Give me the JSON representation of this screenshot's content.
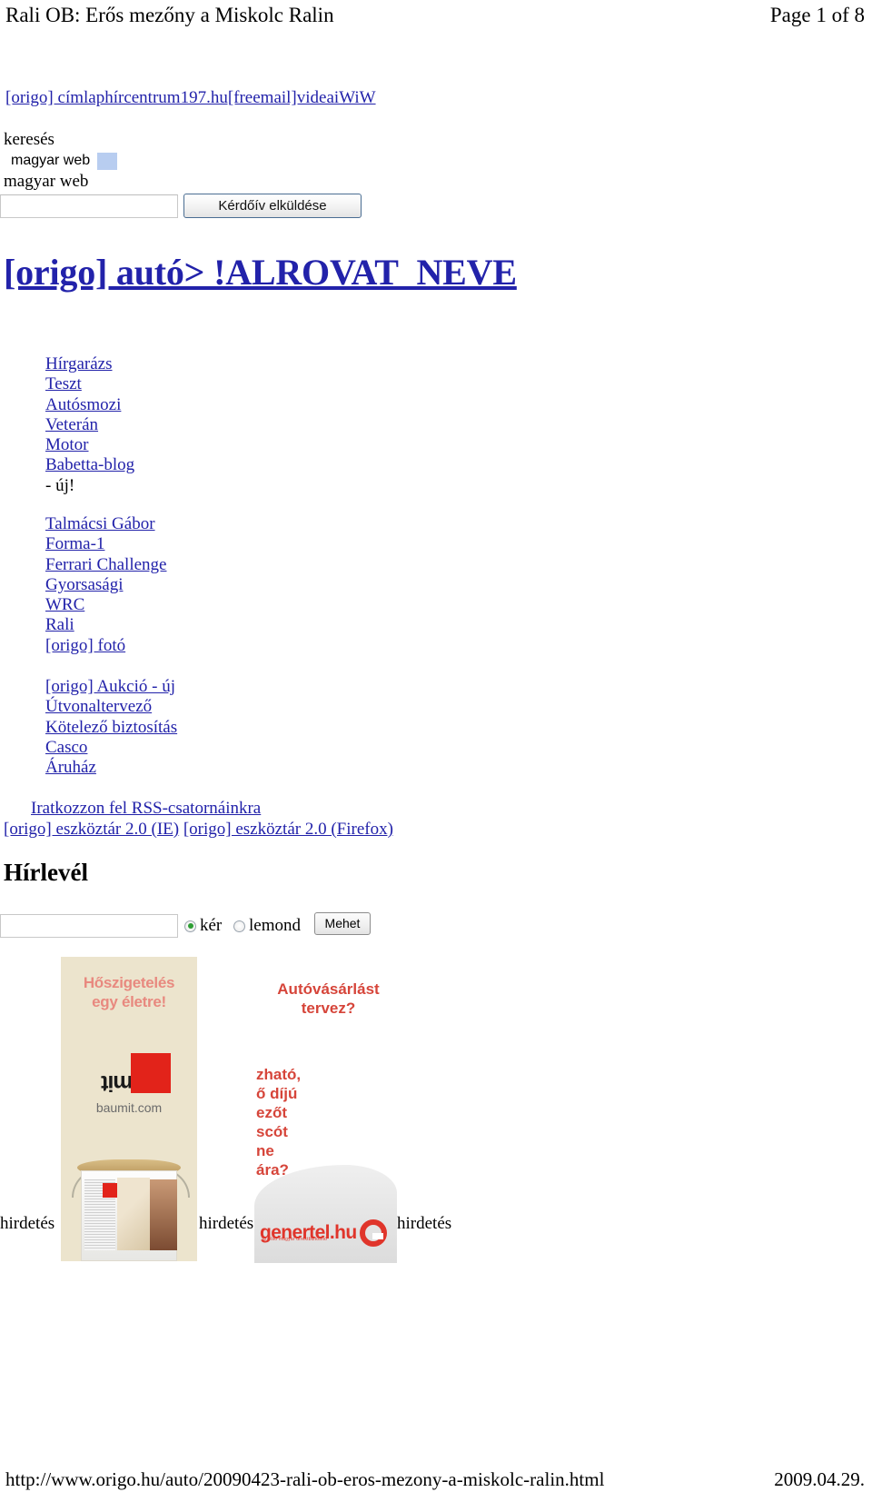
{
  "page_header": {
    "doc_title": "Rali OB: Erős mezőny a Miskolc Ralin",
    "page_number": "Page 1 of 8"
  },
  "top_nav": {
    "text": "[origo] címlaphírcentrum197.hu[freemail]videaiWiW"
  },
  "search": {
    "label": "keresés",
    "scope_option": "magyar web",
    "scope_selected": "magyar web",
    "input_value": "",
    "input_placeholder": "",
    "submit_label": "Kérdőív elküldése"
  },
  "section_title": "[origo] autó> !ALROVAT_NEVE",
  "nav_groups": [
    {
      "items": [
        {
          "label": "Hírgarázs",
          "is_link": true
        },
        {
          "label": "Teszt",
          "is_link": true
        },
        {
          "label": "Autósmozi",
          "is_link": true
        },
        {
          "label": "Veterán",
          "is_link": true
        },
        {
          "label": "Motor",
          "is_link": true
        },
        {
          "label": "Babetta-blog",
          "is_link": true
        },
        {
          "label": "- új!",
          "is_link": false
        }
      ]
    },
    {
      "items": [
        {
          "label": "Talmácsi Gábor",
          "is_link": true
        },
        {
          "label": "Forma-1",
          "is_link": true
        },
        {
          "label": "Ferrari Challenge",
          "is_link": true
        },
        {
          "label": "Gyorsasági",
          "is_link": true
        },
        {
          "label": "WRC",
          "is_link": true
        },
        {
          "label": "Rali",
          "is_link": true
        },
        {
          "label": "[origo] fotó",
          "is_link": true
        }
      ]
    },
    {
      "items": [
        {
          "label": "[origo] Aukció - új",
          "is_link": true
        },
        {
          "label": "Útvonaltervező",
          "is_link": true
        },
        {
          "label": "Kötelező biztosítás",
          "is_link": true
        },
        {
          "label": "Casco",
          "is_link": true
        },
        {
          "label": "Áruház",
          "is_link": true
        }
      ]
    }
  ],
  "rss": {
    "link_label": "Iratkozzon fel RSS-csatornáinkra",
    "toolbar_ie": "[origo] eszköztár 2.0 (IE)",
    "toolbar_firefox": "[origo] eszköztár 2.0 (Firefox)"
  },
  "newsletter": {
    "heading": "Hírlevél",
    "email_value": "",
    "email_placeholder": "",
    "option_subscribe": "kér",
    "option_unsubscribe": "lemond",
    "selected_option": "kér",
    "submit_label": "Mehet"
  },
  "ads": {
    "label": "hirdetés",
    "baumit": {
      "headline_line1": "Hőszigetelés",
      "headline_line2": "egy életre!",
      "logo_text": "baumit",
      "domain": "baumit.com"
    },
    "genertel": {
      "headline_line1": "Autóvásárlást",
      "headline_line2": "tervez?",
      "body_line1": "zható,",
      "body_line2": "ő díjú",
      "body_line3": "ezőt",
      "body_line4": "scót",
      "body_line5": "ne",
      "body_line6": "ára?",
      "logo_text": "genertel.hu",
      "logo_sub": "az első magyar direktbiztosító"
    }
  },
  "page_footer": {
    "url": "http://www.origo.hu/auto/20090423-rali-ob-eros-mezony-a-miskolc-ralin.html",
    "date": "2009.04.29."
  },
  "colors": {
    "link": "#2222aa",
    "baumit_red": "#e2231a",
    "genertel_red": "#e0352b",
    "radio_green": "#2e9e35"
  }
}
